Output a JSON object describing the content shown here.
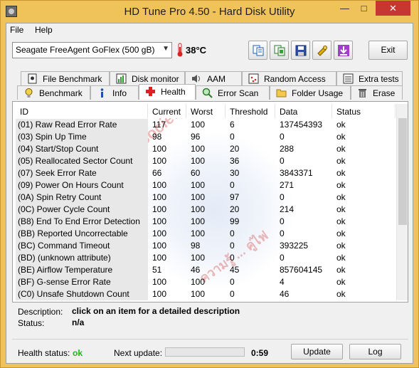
{
  "window": {
    "title": "HD Tune Pro 4.50 - Hard Disk Utility"
  },
  "menu": {
    "file": "File",
    "help": "Help"
  },
  "toolbar": {
    "drive": "Seagate FreeAgent GoFlex (500 gB)",
    "temperature": "38°C",
    "exit_label": "Exit",
    "buttons": [
      "copy-info-icon",
      "copy-screenshot-icon",
      "save-icon",
      "options-icon",
      "download-icon"
    ]
  },
  "tabs_row1": [
    "File Benchmark",
    "Disk monitor",
    "AAM",
    "Random Access",
    "Extra tests"
  ],
  "tabs_row2": [
    "Benchmark",
    "Info",
    "Health",
    "Error Scan",
    "Folder Usage",
    "Erase"
  ],
  "active_tab": "Health",
  "health_table": {
    "columns": [
      "ID",
      "Current",
      "Worst",
      "Threshold",
      "Data",
      "Status"
    ],
    "rows": [
      [
        "(01) Raw Read Error Rate",
        "117",
        "100",
        "6",
        "137454393",
        "ok"
      ],
      [
        "(03) Spin Up Time",
        "98",
        "96",
        "0",
        "0",
        "ok"
      ],
      [
        "(04) Start/Stop Count",
        "100",
        "100",
        "20",
        "288",
        "ok"
      ],
      [
        "(05) Reallocated Sector Count",
        "100",
        "100",
        "36",
        "0",
        "ok"
      ],
      [
        "(07) Seek Error Rate",
        "66",
        "60",
        "30",
        "3843371",
        "ok"
      ],
      [
        "(09) Power On Hours Count",
        "100",
        "100",
        "0",
        "271",
        "ok"
      ],
      [
        "(0A) Spin Retry Count",
        "100",
        "100",
        "97",
        "0",
        "ok"
      ],
      [
        "(0C) Power Cycle Count",
        "100",
        "100",
        "20",
        "214",
        "ok"
      ],
      [
        "(B8) End To End Error Detection",
        "100",
        "100",
        "99",
        "0",
        "ok"
      ],
      [
        "(BB) Reported Uncorrectable Errors",
        "100",
        "100",
        "0",
        "0",
        "ok"
      ],
      [
        "(BC) Command Timeout",
        "100",
        "98",
        "0",
        "393225",
        "ok"
      ],
      [
        "(BD) (unknown attribute)",
        "100",
        "100",
        "0",
        "0",
        "ok"
      ],
      [
        "(BE) Airflow Temperature",
        "51",
        "46",
        "45",
        "857604145",
        "ok"
      ],
      [
        "(BF) G-sense Error Rate",
        "100",
        "100",
        "0",
        "4",
        "ok"
      ],
      [
        "(C0) Unsafe Shutdown Count",
        "100",
        "100",
        "0",
        "46",
        "ok"
      ]
    ]
  },
  "description": {
    "desc_label": "Description:",
    "desc_value": "click on an item for a detailed description",
    "status_label": "Status:",
    "status_value": "n/a"
  },
  "footer": {
    "health_label": "Health status:",
    "health_value": "ok",
    "next_update_label": "Next update:",
    "next_update_value": "0:59",
    "progress_fraction": 0.0,
    "update_label": "Update",
    "log_label": "Log"
  },
  "watermark_text": [
    "Sat Society",
    "ความรู้ ... คู่ไฟ"
  ],
  "colors": {
    "title_bar": "#f0c35a",
    "ok_green": "#1fb51f",
    "close_red": "#c7372f"
  }
}
